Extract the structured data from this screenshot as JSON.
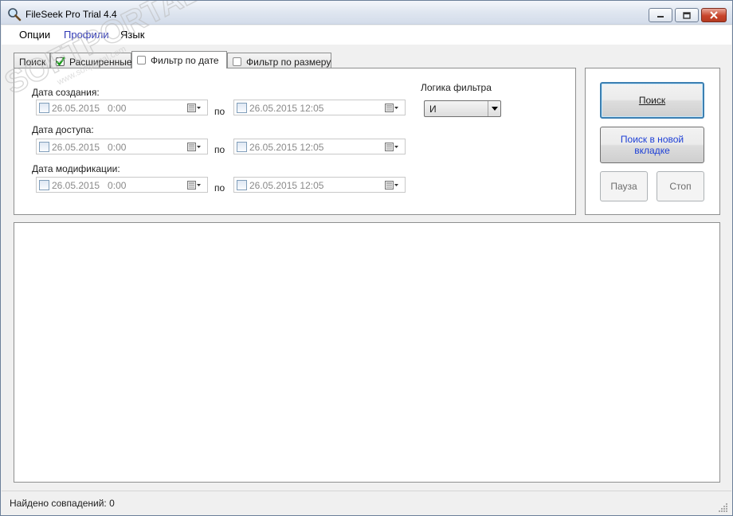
{
  "window": {
    "title": "FileSeek Pro Trial 4.4"
  },
  "menu": {
    "items": [
      {
        "label": "Опции"
      },
      {
        "label": "Профили"
      },
      {
        "label": "Язык"
      }
    ]
  },
  "tabs": [
    {
      "label": "Поиск",
      "checkbox": false
    },
    {
      "label": "Расширенные",
      "checkbox": true,
      "checked": true
    },
    {
      "label": "Фильтр по дате",
      "checkbox": true,
      "checked": false,
      "selected": true
    },
    {
      "label": "Фильтр по размеру",
      "checkbox": true,
      "checked": false
    }
  ],
  "date_filter": {
    "created": {
      "label": "Дата создания:",
      "from": "26.05.2015   0:00",
      "to_label": "по",
      "to": "26.05.2015 12:05"
    },
    "accessed": {
      "label": "Дата доступа:",
      "from": "26.05.2015   0:00",
      "to_label": "по",
      "to": "26.05.2015 12:05"
    },
    "modified": {
      "label": "Дата модификации:",
      "from": "26.05.2015   0:00",
      "to_label": "по",
      "to": "26.05.2015 12:05"
    },
    "logic": {
      "label": "Логика фильтра",
      "value": "И"
    }
  },
  "actions": {
    "search": "Поиск",
    "search_new_tab_line1": "Поиск в новой",
    "search_new_tab_line2": "вкладке",
    "pause": "Пауза",
    "stop": "Стоп"
  },
  "status": {
    "text": "Найдено совпадений: 0"
  },
  "watermark": {
    "text": "SOFTPORTAL",
    "tm": "™",
    "url": "www.softportal.com"
  },
  "colors": {
    "accent": "#3c7fb1",
    "link": "#1d3fd6",
    "menu_active": "#2f38b5"
  }
}
